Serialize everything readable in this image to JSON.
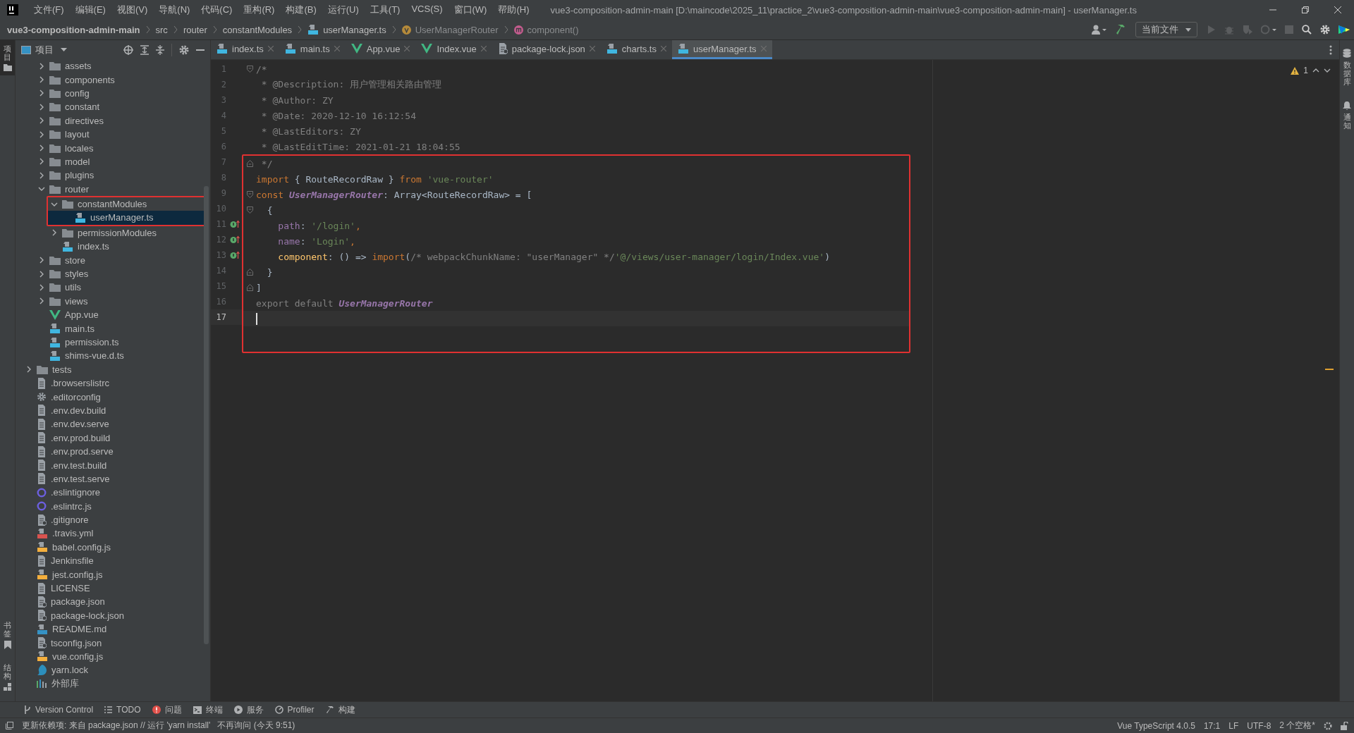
{
  "window": {
    "title": "vue3-composition-admin-main [D:\\maincode\\2025_11\\practice_2\\vue3-composition-admin-main\\vue3-composition-admin-main] - userManager.ts",
    "menu": [
      "文件(F)",
      "编辑(E)",
      "视图(V)",
      "导航(N)",
      "代码(C)",
      "重构(R)",
      "构建(B)",
      "运行(U)",
      "工具(T)",
      "VCS(S)",
      "窗口(W)",
      "帮助(H)"
    ]
  },
  "navbar": {
    "project": "vue3-composition-admin-main",
    "crumbs": [
      {
        "label": "src",
        "kind": "folder"
      },
      {
        "label": "router",
        "kind": "folder"
      },
      {
        "label": "constantModules",
        "kind": "folder"
      },
      {
        "label": "userManager.ts",
        "kind": "file"
      },
      {
        "label": "UserManagerRouter",
        "kind": "variable"
      },
      {
        "label": "component()",
        "kind": "method"
      }
    ],
    "run_config": "当前文件"
  },
  "left_strip": {
    "top": [
      {
        "label": "项目",
        "selected": true
      }
    ],
    "bottom": [
      {
        "label": "书签",
        "selected": false
      },
      {
        "label": "结构",
        "selected": false
      }
    ]
  },
  "right_strip": [
    {
      "label": "数据库"
    },
    {
      "label": "通知"
    }
  ],
  "project_panel": {
    "title": "项目",
    "tree": [
      {
        "kind": "continuation",
        "children": [
          {
            "name": "assets",
            "kind": "folder",
            "expanded": false,
            "selected": false,
            "boxed": false
          },
          {
            "name": "components",
            "kind": "folder",
            "expanded": false,
            "selected": false,
            "boxed": false
          },
          {
            "name": "config",
            "kind": "folder",
            "expanded": false,
            "selected": false,
            "boxed": false
          },
          {
            "name": "constant",
            "kind": "folder",
            "expanded": false,
            "selected": false,
            "boxed": false
          },
          {
            "name": "directives",
            "kind": "folder",
            "expanded": false,
            "selected": false,
            "boxed": false
          },
          {
            "name": "layout",
            "kind": "folder",
            "expanded": false,
            "selected": false,
            "boxed": false
          },
          {
            "name": "locales",
            "kind": "folder",
            "expanded": false,
            "selected": false,
            "boxed": false
          },
          {
            "name": "model",
            "kind": "folder",
            "expanded": false,
            "selected": false,
            "boxed": false
          },
          {
            "name": "plugins",
            "kind": "folder",
            "expanded": false,
            "selected": false,
            "boxed": false
          },
          {
            "name": "router",
            "kind": "folder",
            "expanded": true,
            "selected": false,
            "boxed": false,
            "children": [
              {
                "name": "constantModules",
                "kind": "folder",
                "expanded": true,
                "selected": false,
                "boxed": true,
                "children": [
                  {
                    "name": "userManager.ts",
                    "kind": "ts",
                    "selected": true,
                    "boxed": true
                  }
                ]
              },
              {
                "name": "permissionModules",
                "kind": "folder",
                "expanded": false,
                "selected": false,
                "boxed": false
              },
              {
                "name": "index.ts",
                "kind": "ts",
                "selected": false,
                "boxed": false
              }
            ]
          },
          {
            "name": "store",
            "kind": "folder",
            "expanded": false,
            "selected": false,
            "boxed": false
          },
          {
            "name": "styles",
            "kind": "folder",
            "expanded": false,
            "selected": false,
            "boxed": false
          },
          {
            "name": "utils",
            "kind": "folder",
            "expanded": false,
            "selected": false,
            "boxed": false
          },
          {
            "name": "views",
            "kind": "folder",
            "expanded": false,
            "selected": false,
            "boxed": false
          },
          {
            "name": "App.vue",
            "kind": "vue",
            "selected": false,
            "boxed": false
          },
          {
            "name": "main.ts",
            "kind": "ts",
            "selected": false,
            "boxed": false
          },
          {
            "name": "permission.ts",
            "kind": "ts",
            "selected": false,
            "boxed": false
          },
          {
            "name": "shims-vue.d.ts",
            "kind": "ts",
            "selected": false,
            "boxed": false
          }
        ]
      },
      {
        "name": "tests",
        "kind": "folder",
        "expanded": false,
        "selected": false,
        "boxed": false
      },
      {
        "name": ".browserslistrc",
        "kind": "text",
        "selected": false,
        "boxed": false
      },
      {
        "name": ".editorconfig",
        "kind": "config",
        "selected": false,
        "boxed": false
      },
      {
        "name": ".env.dev.build",
        "kind": "text",
        "selected": false,
        "boxed": false
      },
      {
        "name": ".env.dev.serve",
        "kind": "text",
        "selected": false,
        "boxed": false
      },
      {
        "name": ".env.prod.build",
        "kind": "text",
        "selected": false,
        "boxed": false
      },
      {
        "name": ".env.prod.serve",
        "kind": "text",
        "selected": false,
        "boxed": false
      },
      {
        "name": ".env.test.build",
        "kind": "text",
        "selected": false,
        "boxed": false
      },
      {
        "name": ".env.test.serve",
        "kind": "text",
        "selected": false,
        "boxed": false
      },
      {
        "name": ".eslintignore",
        "kind": "eslint",
        "selected": false,
        "boxed": false
      },
      {
        "name": ".eslintrc.js",
        "kind": "eslint",
        "selected": false,
        "boxed": false
      },
      {
        "name": ".gitignore",
        "kind": "ignore",
        "selected": false,
        "boxed": false
      },
      {
        "name": ".travis.yml",
        "kind": "yml",
        "selected": false,
        "boxed": false
      },
      {
        "name": "babel.config.js",
        "kind": "js",
        "selected": false,
        "boxed": false
      },
      {
        "name": "Jenkinsfile",
        "kind": "text",
        "selected": false,
        "boxed": false
      },
      {
        "name": "jest.config.js",
        "kind": "js",
        "selected": false,
        "boxed": false
      },
      {
        "name": "LICENSE",
        "kind": "text",
        "selected": false,
        "boxed": false
      },
      {
        "name": "package.json",
        "kind": "json",
        "selected": false,
        "boxed": false
      },
      {
        "name": "package-lock.json",
        "kind": "json",
        "selected": false,
        "boxed": false
      },
      {
        "name": "README.md",
        "kind": "md",
        "selected": false,
        "boxed": false
      },
      {
        "name": "tsconfig.json",
        "kind": "json",
        "selected": false,
        "boxed": false
      },
      {
        "name": "vue.config.js",
        "kind": "js",
        "selected": false,
        "boxed": false
      },
      {
        "name": "yarn.lock",
        "kind": "yarn",
        "selected": false,
        "boxed": false
      },
      {
        "name": "外部库",
        "kind": "library",
        "selected": false,
        "boxed": false
      }
    ]
  },
  "editor": {
    "tabs": [
      {
        "label": "index.ts",
        "kind": "ts",
        "selected": false
      },
      {
        "label": "main.ts",
        "kind": "ts",
        "selected": false
      },
      {
        "label": "App.vue",
        "kind": "vue",
        "selected": false
      },
      {
        "label": "Index.vue",
        "kind": "vue",
        "selected": false
      },
      {
        "label": "package-lock.json",
        "kind": "json",
        "selected": false
      },
      {
        "label": "charts.ts",
        "kind": "ts",
        "selected": false
      },
      {
        "label": "userManager.ts",
        "kind": "ts",
        "selected": true
      }
    ],
    "warnings": "1",
    "lines": [
      {
        "number": "1",
        "fold_start": true,
        "fold_end": false,
        "marker": false,
        "current": false,
        "boxed": false,
        "tokens": [
          {
            "kind": "comment",
            "text": "/*"
          }
        ]
      },
      {
        "number": "2",
        "fold_start": false,
        "fold_end": false,
        "marker": false,
        "current": false,
        "boxed": false,
        "tokens": [
          {
            "kind": "comment",
            "text": " * @Description: 用户管理相关路由管理"
          }
        ]
      },
      {
        "number": "3",
        "fold_start": false,
        "fold_end": false,
        "marker": false,
        "current": false,
        "boxed": false,
        "tokens": [
          {
            "kind": "comment",
            "text": " * @Author: ZY"
          }
        ]
      },
      {
        "number": "4",
        "fold_start": false,
        "fold_end": false,
        "marker": false,
        "current": false,
        "boxed": false,
        "tokens": [
          {
            "kind": "comment",
            "text": " * @Date: 2020-12-10 16:12:54"
          }
        ]
      },
      {
        "number": "5",
        "fold_start": false,
        "fold_end": false,
        "marker": false,
        "current": false,
        "boxed": false,
        "tokens": [
          {
            "kind": "comment",
            "text": " * @LastEditors: ZY"
          }
        ]
      },
      {
        "number": "6",
        "fold_start": false,
        "fold_end": false,
        "marker": false,
        "current": false,
        "boxed": false,
        "tokens": [
          {
            "kind": "comment",
            "text": " * @LastEditTime: 2021-01-21 18:04:55"
          }
        ]
      },
      {
        "number": "7",
        "fold_start": false,
        "fold_end": true,
        "marker": false,
        "current": false,
        "boxed": true,
        "tokens": [
          {
            "kind": "comment",
            "text": " */"
          }
        ]
      },
      {
        "number": "8",
        "fold_start": false,
        "fold_end": false,
        "marker": false,
        "current": false,
        "boxed": true,
        "tokens": [
          {
            "kind": "keyword",
            "text": "import"
          },
          {
            "kind": "plain",
            "text": " { RouteRecordRaw } "
          },
          {
            "kind": "keyword",
            "text": "from"
          },
          {
            "kind": "string",
            "text": " 'vue-router'"
          }
        ]
      },
      {
        "number": "9",
        "fold_start": true,
        "fold_end": false,
        "marker": false,
        "current": false,
        "boxed": true,
        "tokens": [
          {
            "kind": "keyword",
            "text": "const"
          },
          {
            "kind": "constant",
            "text": " UserManagerRouter"
          },
          {
            "kind": "plain",
            "text": ": Array<RouteRecordRaw> = ["
          }
        ]
      },
      {
        "number": "10",
        "fold_start": true,
        "fold_end": false,
        "marker": false,
        "current": false,
        "boxed": true,
        "tokens": [
          {
            "kind": "plain",
            "text": "  {"
          }
        ]
      },
      {
        "number": "11",
        "fold_start": false,
        "fold_end": false,
        "marker": true,
        "current": false,
        "boxed": true,
        "tokens": [
          {
            "kind": "field",
            "text": "    path"
          },
          {
            "kind": "plain",
            "text": ": "
          },
          {
            "kind": "string",
            "text": "'/login'"
          },
          {
            "kind": "keyword",
            "text": ","
          }
        ]
      },
      {
        "number": "12",
        "fold_start": false,
        "fold_end": false,
        "marker": true,
        "current": false,
        "boxed": true,
        "tokens": [
          {
            "kind": "field",
            "text": "    name"
          },
          {
            "kind": "plain",
            "text": ": "
          },
          {
            "kind": "string",
            "text": "'Login'"
          },
          {
            "kind": "keyword",
            "text": ","
          }
        ]
      },
      {
        "number": "13",
        "fold_start": false,
        "fold_end": false,
        "marker": true,
        "current": false,
        "boxed": true,
        "tokens": [
          {
            "kind": "method",
            "text": "    component"
          },
          {
            "kind": "plain",
            "text": ": () => "
          },
          {
            "kind": "keyword",
            "text": "import"
          },
          {
            "kind": "plain",
            "text": "("
          },
          {
            "kind": "comment",
            "text": "/* webpackChunkName: \"userManager\" */"
          },
          {
            "kind": "string",
            "text": "'@/views/user-manager/login/Index.vue'"
          },
          {
            "kind": "plain",
            "text": ")"
          }
        ]
      },
      {
        "number": "14",
        "fold_start": false,
        "fold_end": true,
        "marker": false,
        "current": false,
        "boxed": true,
        "tokens": [
          {
            "kind": "plain",
            "text": "  }"
          }
        ]
      },
      {
        "number": "15",
        "fold_start": false,
        "fold_end": true,
        "marker": false,
        "current": false,
        "boxed": true,
        "tokens": [
          {
            "kind": "plain",
            "text": "]"
          }
        ]
      },
      {
        "number": "16",
        "fold_start": false,
        "fold_end": false,
        "marker": false,
        "current": false,
        "boxed": true,
        "tokens": [
          {
            "kind": "muted",
            "text": "export default "
          },
          {
            "kind": "constant",
            "text": "UserManagerRouter"
          }
        ]
      },
      {
        "number": "17",
        "fold_start": false,
        "fold_end": false,
        "marker": false,
        "current": true,
        "boxed": true
      }
    ]
  },
  "bottom_tools": [
    "Version Control",
    "TODO",
    "问题",
    "终端",
    "服务",
    "Profiler",
    "构建"
  ],
  "status_bar": {
    "message": "更新依赖项: 来自 package.json // 运行 'yarn install'   不再询问 (今天 9:51)",
    "items": [
      "Vue TypeScript 4.0.5",
      "17:1",
      "LF",
      "UTF-8",
      "2 个空格*"
    ]
  }
}
